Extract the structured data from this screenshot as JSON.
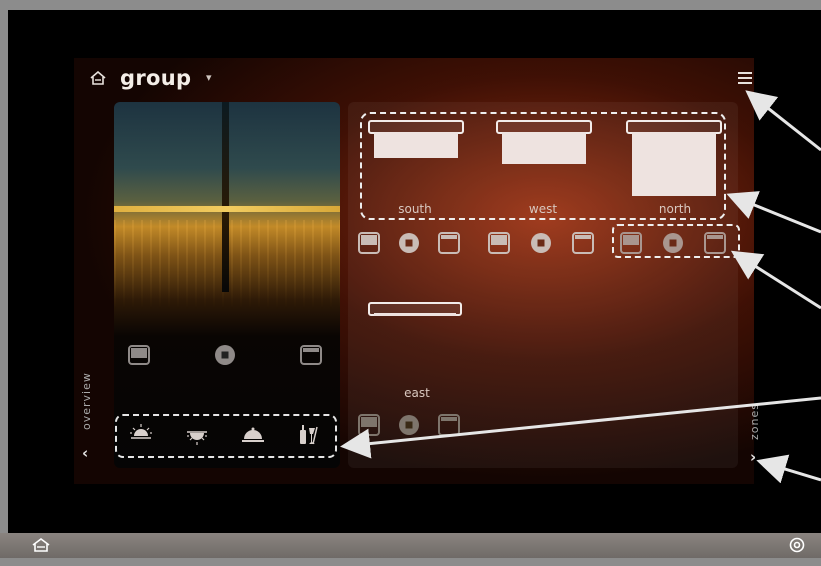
{
  "header": {
    "title": "group",
    "caret": "▾",
    "home_icon": "house-icon",
    "menu_icon": "hamburger-menu-icon"
  },
  "left_card": {
    "controls": [
      "shade-lower-icon",
      "shade-stop-icon",
      "shade-raise-icon"
    ],
    "presets": [
      "sunrise-icon",
      "sunset-icon",
      "dinner-icon",
      "entertain-icon"
    ]
  },
  "zones": {
    "shades": [
      {
        "label": "south",
        "level": 0.35
      },
      {
        "label": "west",
        "level": 0.5
      },
      {
        "label": "north",
        "level": 1.0
      },
      {
        "label": "east",
        "level": 0.15
      }
    ]
  },
  "nav": {
    "left_label": "overview",
    "left_chevron": "‹",
    "right_label": "zones",
    "right_chevron": "›"
  },
  "statusbar": {
    "home_icon": "house-icon",
    "settings_icon": "settings-icon"
  },
  "colors": {
    "accent_glow": "#a83814",
    "panel_bg": "#150604",
    "status_bar": "#7d7874",
    "annotation": "#e6e6e6"
  }
}
